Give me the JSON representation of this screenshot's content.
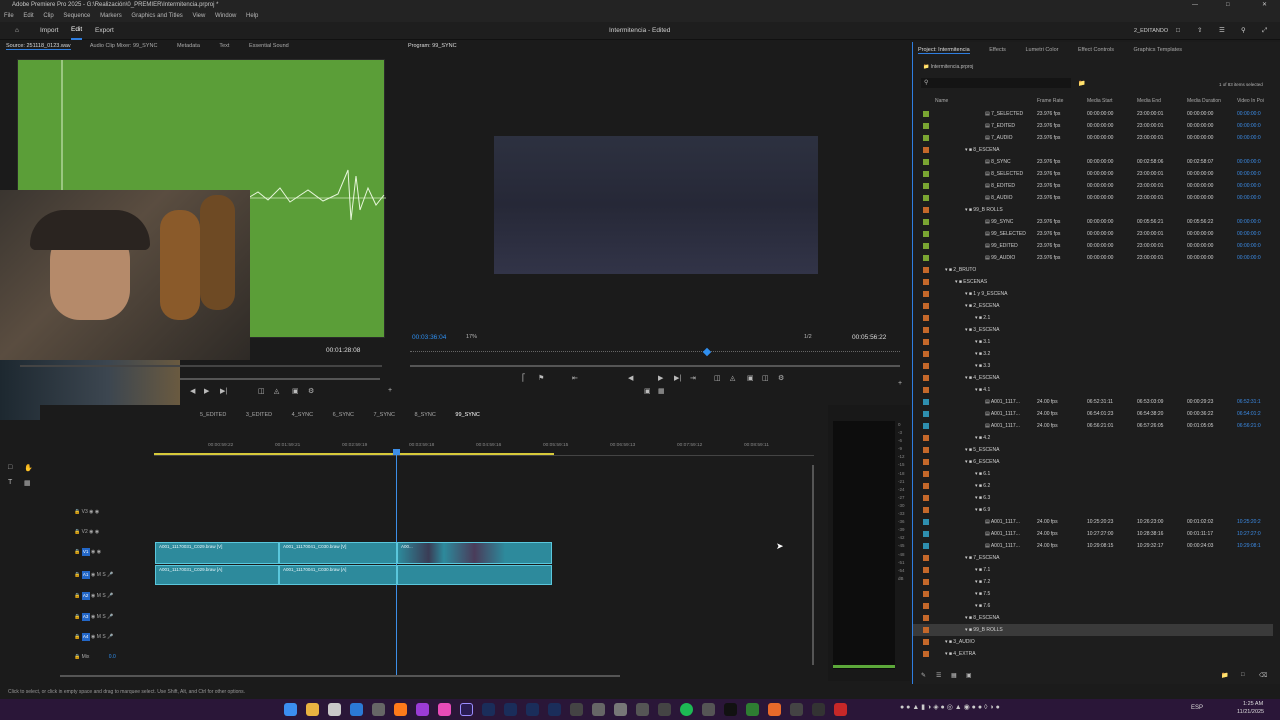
{
  "window": {
    "title": "Adobe Premiere Pro 2025 - G:\\Realización\\0_PREMIER\\Intermitencia.prproj *",
    "menu": [
      "File",
      "Edit",
      "Clip",
      "Sequence",
      "Markers",
      "Graphics and Titles",
      "View",
      "Window",
      "Help"
    ],
    "doc_title": "Intermitencia - Edited",
    "workspace_tabs": [
      "Import",
      "Edit",
      "Export"
    ],
    "workspace_name": "2_EDITANDO"
  },
  "source": {
    "tabs": [
      "Source: 251118_0123.wav",
      "Audio Clip Mixer: 99_SYNC",
      "Metadata",
      "Text",
      "Essential Sound"
    ],
    "timecode": "00:01:28:08"
  },
  "program": {
    "title": "Program: 99_SYNC",
    "timecode": "00:03:36:04",
    "zoom": "17%",
    "resolution": "1/2",
    "duration": "00:05:56:22"
  },
  "timeline": {
    "tabs": [
      "5_EDITED",
      "3_EDITED",
      "4_SYNC",
      "6_SYNC",
      "7_SYNC",
      "8_SYNC",
      "99_SYNC"
    ],
    "ruler": [
      "00:00:59:22",
      "00:01:59:21",
      "00:02:59:19",
      "00:03:59:18",
      "00:04:59:16",
      "00:05:59:15",
      "00:06:59:13",
      "00:07:59:12",
      "00:08:59:11"
    ],
    "tracks": [
      "V3",
      "V2",
      "V1",
      "A1",
      "A2",
      "A3",
      "A4"
    ],
    "mix_label": "Mix",
    "mix_value": "0.0",
    "clips_video": [
      "A001_11170031_C029.braw [V]",
      "A001_11170041_C030.braw [V]",
      "A00..."
    ],
    "clips_audio": [
      "A001_11170031_C029.braw [A]",
      "A001_11170041_C030.braw [A]"
    ]
  },
  "meter_scale": [
    "0",
    "-3",
    "-6",
    "-9",
    "-12",
    "-15",
    "-18",
    "-21",
    "-24",
    "-27",
    "-30",
    "-33",
    "-36",
    "-39",
    "-42",
    "-45",
    "-48",
    "-51",
    "-54",
    "dB"
  ],
  "project": {
    "tabs": [
      "Project: Intermitencia",
      "Effects",
      "Lumetri Color",
      "Effect Controls",
      "Graphics Templates"
    ],
    "file": "Intermitencia.prproj",
    "selection": "1 of 83 items selected",
    "columns": [
      "Name",
      "Frame Rate",
      "Media Start",
      "Media End",
      "Media Duration",
      "Video In Poi"
    ],
    "rows": [
      {
        "indent": 5,
        "name": "7_SELECTED",
        "fr": "23.976 fps",
        "ms": "00:00:00:00",
        "me": "23:00:00:01",
        "md": "00:00:00:00",
        "vi": "00:00:00:0",
        "color": "#7aa532"
      },
      {
        "indent": 5,
        "name": "7_EDITED",
        "fr": "23.976 fps",
        "ms": "00:00:00:00",
        "me": "23:00:00:01",
        "md": "00:00:00:00",
        "vi": "00:00:00:0",
        "color": "#7aa532"
      },
      {
        "indent": 5,
        "name": "7_AUDIO",
        "fr": "23.976 fps",
        "ms": "00:00:00:00",
        "me": "23:00:00:01",
        "md": "00:00:00:00",
        "vi": "00:00:00:0",
        "color": "#7aa532"
      },
      {
        "indent": 3,
        "name": "8_ESCENA",
        "folder": true,
        "color": "#c5682a"
      },
      {
        "indent": 5,
        "name": "8_SYNC",
        "fr": "23.976 fps",
        "ms": "00:00:00:00",
        "me": "00:02:58:06",
        "md": "00:02:58:07",
        "vi": "00:00:00:0",
        "color": "#7aa532"
      },
      {
        "indent": 5,
        "name": "8_SELECTED",
        "fr": "23.976 fps",
        "ms": "00:00:00:00",
        "me": "23:00:00:01",
        "md": "00:00:00:00",
        "vi": "00:00:00:0",
        "color": "#7aa532"
      },
      {
        "indent": 5,
        "name": "8_EDITED",
        "fr": "23.976 fps",
        "ms": "00:00:00:00",
        "me": "23:00:00:01",
        "md": "00:00:00:00",
        "vi": "00:00:00:0",
        "color": "#7aa532"
      },
      {
        "indent": 5,
        "name": "8_AUDIO",
        "fr": "23.976 fps",
        "ms": "00:00:00:00",
        "me": "23:00:00:01",
        "md": "00:00:00:00",
        "vi": "00:00:00:0",
        "color": "#7aa532"
      },
      {
        "indent": 3,
        "name": "99_B ROLLS",
        "folder": true,
        "color": "#c5682a"
      },
      {
        "indent": 5,
        "name": "99_SYNC",
        "fr": "23.976 fps",
        "ms": "00:00:00:00",
        "me": "00:05:56:21",
        "md": "00:05:56:22",
        "vi": "00:00:00:0",
        "color": "#7aa532"
      },
      {
        "indent": 5,
        "name": "99_SELECTED",
        "fr": "23.976 fps",
        "ms": "00:00:00:00",
        "me": "23:00:00:01",
        "md": "00:00:00:00",
        "vi": "00:00:00:0",
        "color": "#7aa532"
      },
      {
        "indent": 5,
        "name": "99_EDITED",
        "fr": "23.976 fps",
        "ms": "00:00:00:00",
        "me": "23:00:00:01",
        "md": "00:00:00:00",
        "vi": "00:00:00:0",
        "color": "#7aa532"
      },
      {
        "indent": 5,
        "name": "99_AUDIO",
        "fr": "23.976 fps",
        "ms": "00:00:00:00",
        "me": "23:00:00:01",
        "md": "00:00:00:00",
        "vi": "00:00:00:0",
        "color": "#7aa532"
      },
      {
        "indent": 1,
        "name": "2_BRUTO",
        "folder": true,
        "color": "#c5682a"
      },
      {
        "indent": 2,
        "name": "ESCENAS",
        "folder": true,
        "color": "#c5682a"
      },
      {
        "indent": 3,
        "name": "1 y 9_ESCENA",
        "folder": true,
        "color": "#c5682a"
      },
      {
        "indent": 3,
        "name": "2_ESCENA",
        "folder": true,
        "color": "#c5682a"
      },
      {
        "indent": 4,
        "name": "2.1",
        "folder": true,
        "color": "#c5682a"
      },
      {
        "indent": 3,
        "name": "3_ESCENA",
        "folder": true,
        "color": "#c5682a"
      },
      {
        "indent": 4,
        "name": "3.1",
        "folder": true,
        "color": "#c5682a"
      },
      {
        "indent": 4,
        "name": "3.2",
        "folder": true,
        "color": "#c5682a"
      },
      {
        "indent": 4,
        "name": "3.3",
        "folder": true,
        "color": "#c5682a"
      },
      {
        "indent": 3,
        "name": "4_ESCENA",
        "folder": true,
        "color": "#c5682a"
      },
      {
        "indent": 4,
        "name": "4.1",
        "folder": true,
        "color": "#c5682a"
      },
      {
        "indent": 5,
        "name": "A001_1117...",
        "fr": "24.00 fps",
        "ms": "06:52:31:11",
        "me": "06:53:03:09",
        "md": "00:00:29:23",
        "vi": "06:52:31:1",
        "color": "#2e8fb0"
      },
      {
        "indent": 5,
        "name": "A001_1117...",
        "fr": "24.00 fps",
        "ms": "06:54:01:23",
        "me": "06:54:38:20",
        "md": "00:00:36:22",
        "vi": "06:54:01:2",
        "color": "#2e8fb0"
      },
      {
        "indent": 5,
        "name": "A001_1117...",
        "fr": "24.00 fps",
        "ms": "06:56:21:01",
        "me": "06:57:26:05",
        "md": "00:01:05:05",
        "vi": "06:56:21:0",
        "color": "#2e8fb0"
      },
      {
        "indent": 4,
        "name": "4.2",
        "folder": true,
        "color": "#c5682a"
      },
      {
        "indent": 3,
        "name": "5_ESCENA",
        "folder": true,
        "color": "#c5682a"
      },
      {
        "indent": 3,
        "name": "6_ESCENA",
        "folder": true,
        "color": "#c5682a"
      },
      {
        "indent": 4,
        "name": "6.1",
        "folder": true,
        "color": "#c5682a"
      },
      {
        "indent": 4,
        "name": "6.2",
        "folder": true,
        "color": "#c5682a"
      },
      {
        "indent": 4,
        "name": "6.3",
        "folder": true,
        "color": "#c5682a"
      },
      {
        "indent": 4,
        "name": "6.9",
        "folder": true,
        "color": "#c5682a"
      },
      {
        "indent": 5,
        "name": "A001_1117...",
        "fr": "24.00 fps",
        "ms": "10:25:20:23",
        "me": "10:26:23:00",
        "md": "00:01:02:02",
        "vi": "10:25:20:2",
        "color": "#2e8fb0"
      },
      {
        "indent": 5,
        "name": "A001_1117...",
        "fr": "24.00 fps",
        "ms": "10:27:27:00",
        "me": "10:28:38:16",
        "md": "00:01:11:17",
        "vi": "10:27:27:0",
        "color": "#2e8fb0"
      },
      {
        "indent": 5,
        "name": "A001_1117...",
        "fr": "24.00 fps",
        "ms": "10:29:08:15",
        "me": "10:29:32:17",
        "md": "00:00:24:03",
        "vi": "10:29:08:1",
        "color": "#2e8fb0"
      },
      {
        "indent": 3,
        "name": "7_ESCENA",
        "folder": true,
        "color": "#c5682a"
      },
      {
        "indent": 4,
        "name": "7.1",
        "folder": true,
        "color": "#c5682a"
      },
      {
        "indent": 4,
        "name": "7.2",
        "folder": true,
        "color": "#c5682a"
      },
      {
        "indent": 4,
        "name": "7.5",
        "folder": true,
        "color": "#c5682a"
      },
      {
        "indent": 4,
        "name": "7.6",
        "folder": true,
        "color": "#c5682a"
      },
      {
        "indent": 3,
        "name": "8_ESCENA",
        "folder": true,
        "color": "#c5682a"
      },
      {
        "indent": 3,
        "name": "99_B ROLLS",
        "folder": true,
        "color": "#c5682a",
        "selected": true
      },
      {
        "indent": 1,
        "name": "3_AUDIO",
        "folder": true,
        "color": "#c5682a"
      },
      {
        "indent": 1,
        "name": "4_EXTRA",
        "folder": true,
        "color": "#c5682a"
      }
    ]
  },
  "status_hint": "Click to select, or click in empty space and drag to marquee select. Use Shift, Alt, and Ctrl for other options.",
  "taskbar": {
    "language": "ESP",
    "time": "1:25 AM",
    "date": "11/21/2025"
  }
}
